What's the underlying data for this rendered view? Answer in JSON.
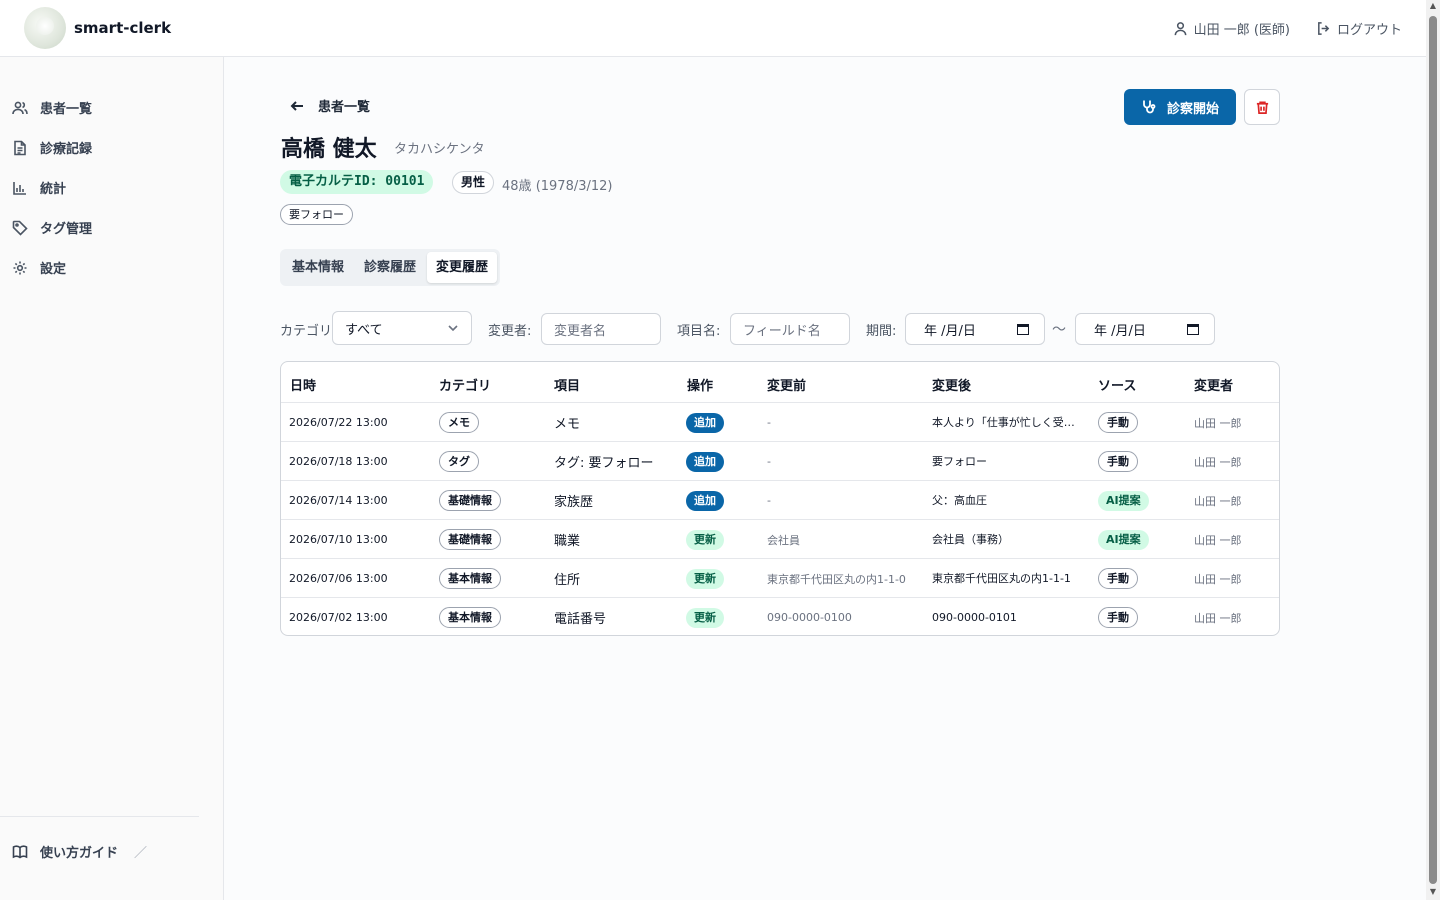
{
  "app": {
    "name": "smart-clerk"
  },
  "header": {
    "user": "山田 一郎 (医師)",
    "logout": "ログアウト"
  },
  "sidebar": {
    "items": [
      {
        "label": "患者一覧",
        "icon": "users-icon"
      },
      {
        "label": "診療記録",
        "icon": "document-icon"
      },
      {
        "label": "統計",
        "icon": "bar-chart-icon"
      },
      {
        "label": "タグ管理",
        "icon": "tag-icon"
      },
      {
        "label": "設定",
        "icon": "gear-icon"
      }
    ],
    "guide": "使い方ガイド"
  },
  "page": {
    "back_label": "患者一覧",
    "patient_name": "高橋 健太",
    "patient_kana": "タカハシケンタ",
    "ehr_id": "電子カルテID: 00101",
    "gender": "男性",
    "age": "48歳",
    "birthdate": "(1978/3/12)",
    "tag": "要フォロー",
    "start_button": "診察開始",
    "tabs": [
      "基本情報",
      "診察履歴",
      "変更履歴"
    ],
    "active_tab": "変更履歴"
  },
  "filters": {
    "category_label": "カテゴリ:",
    "category_value": "すべて",
    "changer_label": "変更者:",
    "changer_placeholder": "変更者名",
    "field_label": "項目名:",
    "field_placeholder": "フィールド名",
    "period_label": "期間:",
    "date_from": "年 /月/日",
    "date_to": "年 /月/日",
    "range_sep": "〜"
  },
  "table": {
    "headers": [
      "日時",
      "カテゴリ",
      "項目",
      "操作",
      "変更前",
      "変更後",
      "ソース",
      "変更者"
    ],
    "rows": [
      {
        "datetime": "2026/07/22 13:00",
        "category": "メモ",
        "item": "メモ",
        "op": "追加",
        "op_type": "add",
        "before": "-",
        "after": "本人より「仕事が忙しく受診できていなかった」と",
        "source": "手動",
        "source_type": "manual",
        "changer": "山田 一郎"
      },
      {
        "datetime": "2026/07/18 13:00",
        "category": "タグ",
        "item": "タグ: 要フォロー",
        "op": "追加",
        "op_type": "add",
        "before": "-",
        "after": "要フォロー",
        "source": "手動",
        "source_type": "manual",
        "changer": "山田 一郎"
      },
      {
        "datetime": "2026/07/14 13:00",
        "category": "基礎情報",
        "item": "家族歴",
        "op": "追加",
        "op_type": "add",
        "before": "-",
        "after": "父：高血圧",
        "source": "AI提案",
        "source_type": "ai",
        "changer": "山田 一郎"
      },
      {
        "datetime": "2026/07/10 13:00",
        "category": "基礎情報",
        "item": "職業",
        "op": "更新",
        "op_type": "update",
        "before": "会社員",
        "after": "会社員（事務）",
        "source": "AI提案",
        "source_type": "ai",
        "changer": "山田 一郎"
      },
      {
        "datetime": "2026/07/06 13:00",
        "category": "基本情報",
        "item": "住所",
        "op": "更新",
        "op_type": "update",
        "before": "東京都千代田区丸の内1-1-0",
        "after": "東京都千代田区丸の内1-1-1",
        "source": "手動",
        "source_type": "manual",
        "changer": "山田 一郎"
      },
      {
        "datetime": "2026/07/02 13:00",
        "category": "基本情報",
        "item": "電話番号",
        "op": "更新",
        "op_type": "update",
        "before": "090-0000-0100",
        "after": "090-0000-0101",
        "source": "手動",
        "source_type": "manual",
        "changer": "山田 一郎"
      }
    ]
  },
  "colors": {
    "primary": "#0a66a8",
    "success_bg": "#d1fae5",
    "success_text": "#065f46",
    "danger": "#dc2626"
  }
}
